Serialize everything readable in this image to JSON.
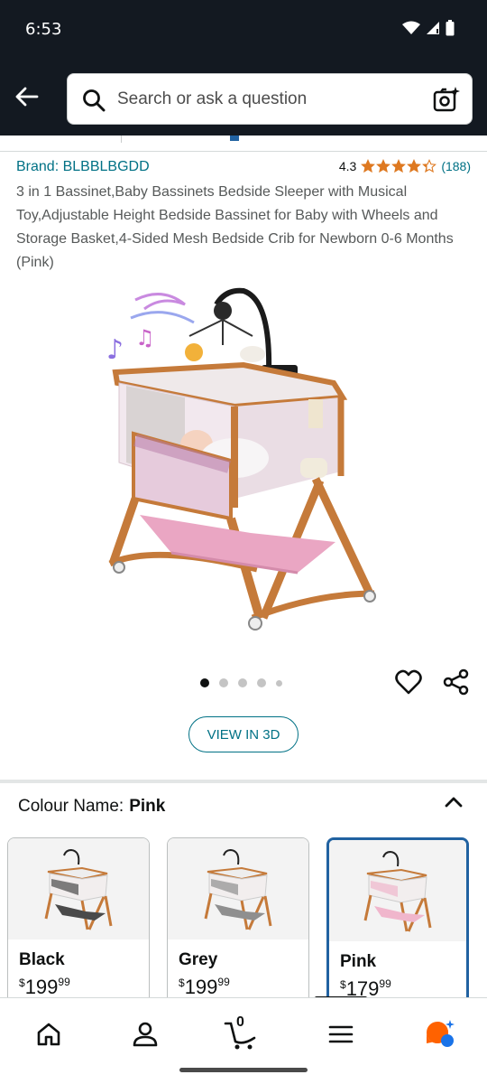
{
  "status": {
    "time": "6:53"
  },
  "search": {
    "placeholder": "Search or ask a question"
  },
  "product": {
    "brand": "Brand: BLBBLBGDD",
    "rating": "4.3",
    "rating_value": 4.3,
    "review_count": "(188)",
    "title": "3 in 1 Bassinet,Baby Bassinets Bedside Sleeper with Musical Toy,Adjustable Height Bedside Bassinet for Baby with Wheels and Storage Basket,4-Sided Mesh Bedside Crib for Newborn 0-6 Months (Pink)",
    "image_count": 5,
    "active_image": 1,
    "view_3d_label": "VIEW IN 3D"
  },
  "colour": {
    "label": "Colour Name:",
    "selected": "Pink",
    "options": [
      {
        "name": "Black",
        "currency": "$",
        "price_whole": "199",
        "price_fraction": "99"
      },
      {
        "name": "Grey",
        "currency": "$",
        "price_whole": "199",
        "price_fraction": "99"
      },
      {
        "name": "Pink",
        "currency": "$",
        "price_whole": "179",
        "price_fraction": "99"
      }
    ]
  },
  "cart": {
    "count": "0"
  },
  "colors": {
    "header_bg": "#131921",
    "link": "#007185",
    "star": "#de7921",
    "selected_border": "#2162a1"
  },
  "icons": [
    "back-arrow-icon",
    "search-icon",
    "camera-search-icon",
    "heart-icon",
    "share-icon",
    "chevron-up-icon",
    "home-icon",
    "account-icon",
    "cart-icon",
    "menu-icon",
    "rufus-ai-icon"
  ]
}
